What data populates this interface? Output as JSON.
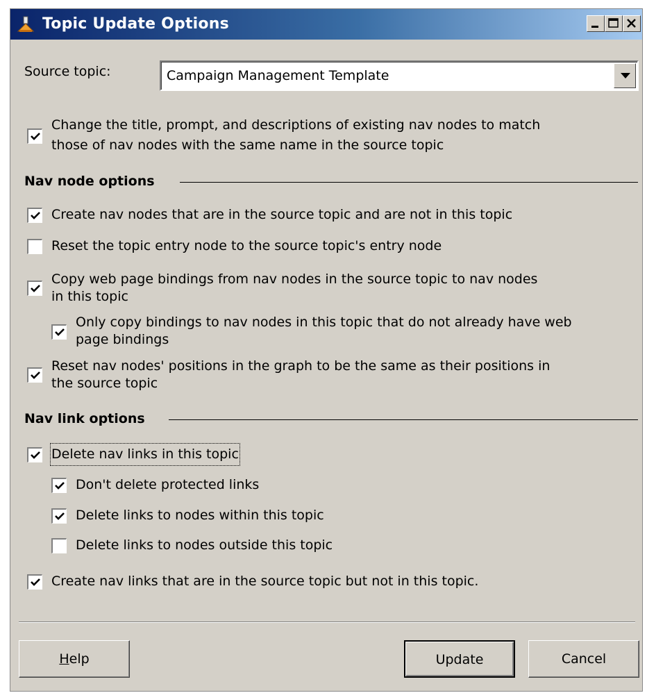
{
  "window": {
    "title": "Topic Update Options",
    "controls": {
      "minimize_icon": "minimize-icon",
      "maximize_icon": "maximize-icon",
      "close_icon": "close-icon"
    }
  },
  "source_topic": {
    "label": "Source topic:",
    "value": "Campaign Management Template"
  },
  "change_title": {
    "checked": true,
    "line1": "Change the title, prompt, and descriptions of existing nav nodes to match",
    "line2": "those of nav nodes with the same name in the source topic"
  },
  "nav_node_options": {
    "heading": "Nav node options",
    "create_nodes": {
      "checked": true,
      "label": "Create nav nodes that are in the source topic and are not in this topic"
    },
    "reset_entry": {
      "checked": false,
      "label": "Reset the topic entry node to the source topic's entry node"
    },
    "copy_bindings": {
      "checked": true,
      "line1": "Copy web page bindings from nav nodes in the source topic to nav nodes",
      "line2": "in this topic"
    },
    "only_copy": {
      "checked": true,
      "line1": "Only copy bindings to nav nodes in this topic that do not already have web",
      "line2": "page bindings"
    },
    "reset_positions": {
      "checked": true,
      "line1": "Reset nav nodes' positions in the graph to be the same as their positions in",
      "line2": "the source topic"
    }
  },
  "nav_link_options": {
    "heading": "Nav link options",
    "delete_links": {
      "checked": true,
      "label": "Delete nav links in this topic"
    },
    "dont_delete_protected": {
      "checked": true,
      "label": "Don't delete protected links"
    },
    "delete_within": {
      "checked": true,
      "label": "Delete links to nodes within this topic"
    },
    "delete_outside": {
      "checked": false,
      "label": "Delete links to nodes outside this topic"
    },
    "create_links": {
      "checked": true,
      "label": "Create nav links that are in the source topic but not in this topic."
    }
  },
  "buttons": {
    "help_mnemonic": "H",
    "help_rest": "elp",
    "update": "Update",
    "cancel": "Cancel"
  }
}
